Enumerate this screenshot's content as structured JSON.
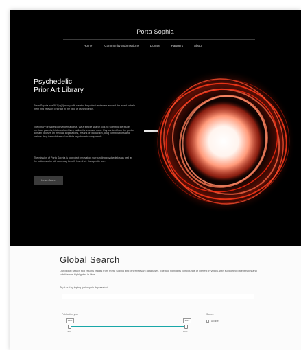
{
  "site": {
    "title": "Porta Sophia",
    "nav": [
      "Home",
      "Community Submissions",
      "Donate",
      "Partners",
      "About"
    ]
  },
  "hero": {
    "heading_line1": "Psychedelic",
    "heading_line2": "Prior Art Library",
    "paragraph1": "Porta Sophia is a 501(c)(3) non-profit created for patent reviewers around the world to help them find relevant prior art in the field of psychedelics.",
    "paragraph2": "The library provides convenient access, via a simple search tool, to scientific literature, previous patents, historical archives, online forums and more. Key content from the public domain focuses on medical applications, means of production, drug combinations and various drug formulations of multiple psychedelic compounds.",
    "paragraph3": "The mission of Porta Sophia is to protect innovation surrounding psychedelics as well as the patients who will someday benefit from their therapeutic use.",
    "learn_more_label": "Learn More",
    "colors": {
      "background": "#000000",
      "orb_core": "#ffffff",
      "orb_glow": "#ff3a1a"
    },
    "icons": {
      "orb": "glowing-orb-graphic"
    }
  },
  "search": {
    "title": "Global Search",
    "description": "Our global search tool returns results from Porta Sophia and other relevant databases. The tool highlights compounds of interest in yellow, with supporting patent types and sub-themes highlighted in blue.",
    "try_text": "Try it out by typing \"psilocybin depression\"",
    "input_value": "",
    "input_placeholder": "",
    "filters": {
      "publication_year_label": "Publication year",
      "year_min": "1900",
      "year_max": "2021",
      "range_fraction": [
        0.0,
        1.0
      ],
      "source_label": "Source",
      "source_option": "Archive"
    },
    "colors": {
      "slider_fill": "#19a7a8",
      "input_border": "#4a7fbf"
    }
  }
}
